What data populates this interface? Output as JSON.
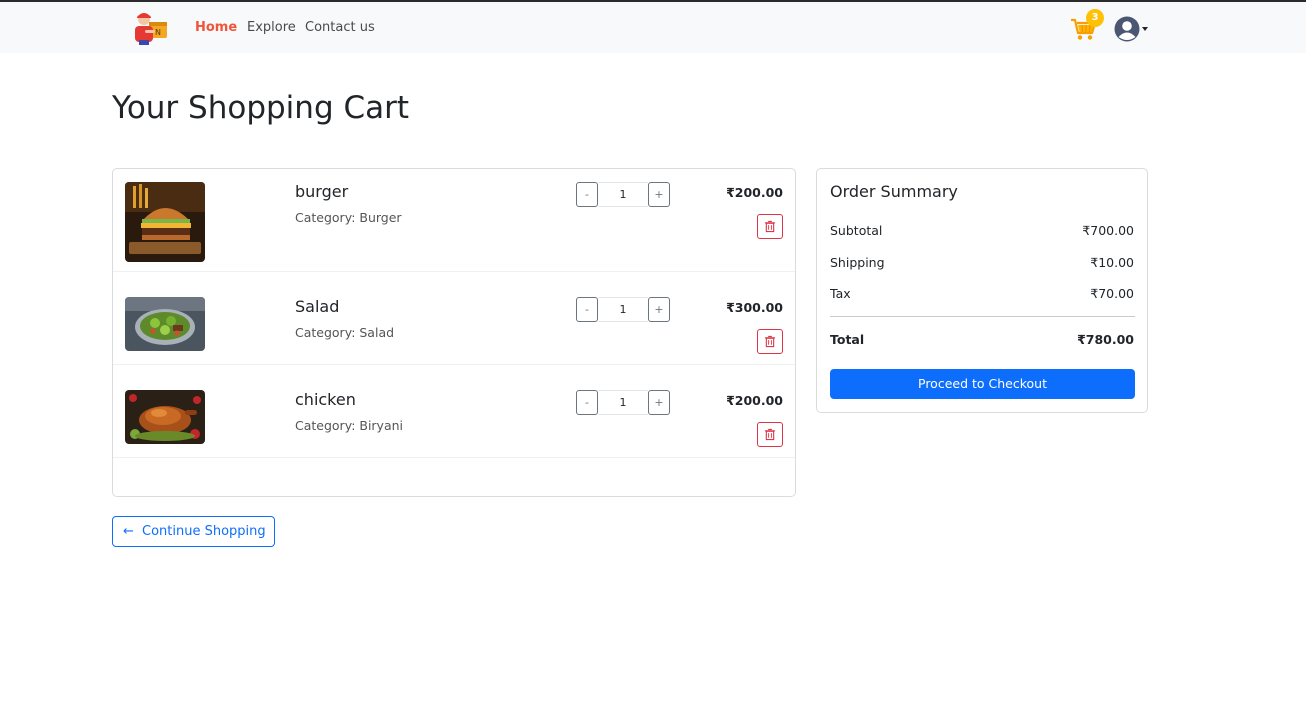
{
  "nav": {
    "links": [
      "Home",
      "Explore",
      "Contact us"
    ],
    "cart_count": "3",
    "accent_color": "#f0553c",
    "badge_color": "#ffc107"
  },
  "page": {
    "title": "Your Shopping Cart"
  },
  "cart": {
    "items": [
      {
        "name": "burger",
        "category": "Category: Burger",
        "quantity": "1",
        "price": "₹200.00",
        "image_icon": "burger-image"
      },
      {
        "name": "Salad",
        "category": "Category: Salad",
        "quantity": "1",
        "price": "₹300.00",
        "image_icon": "salad-image"
      },
      {
        "name": "chicken",
        "category": "Category: Biryani",
        "quantity": "1",
        "price": "₹200.00",
        "image_icon": "roast-chicken-image"
      }
    ],
    "minus_label": "-",
    "plus_label": "+"
  },
  "summary": {
    "title": "Order Summary",
    "rows": [
      {
        "label": "Subtotal",
        "value": "₹700.00"
      },
      {
        "label": "Shipping",
        "value": "₹10.00"
      },
      {
        "label": "Tax",
        "value": "₹70.00"
      }
    ],
    "total_label": "Total",
    "total_value": "₹780.00",
    "checkout_label": "Proceed to Checkout",
    "primary_color": "#0d6efd"
  },
  "continue": {
    "arrow": "←",
    "label": "Continue Shopping"
  },
  "danger_color": "#dc3545"
}
